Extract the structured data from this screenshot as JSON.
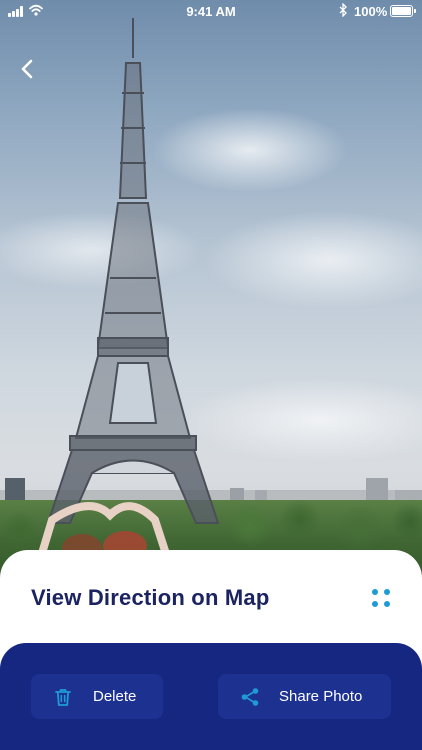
{
  "status_bar": {
    "time": "9:41 AM",
    "battery_percent": "100%",
    "battery_level": 1.0,
    "bluetooth_icon": "bluetooth-icon",
    "wifi_icon": "wifi-icon",
    "signal_icon": "cellular-signal-icon"
  },
  "header": {
    "back_icon": "chevron-left-icon"
  },
  "photo": {
    "subject_icon": "eiffel-tower-photo"
  },
  "card": {
    "title": "View Direction on Map",
    "grid_icon": "four-dots-grid-icon"
  },
  "actions": {
    "delete_label": "Delete",
    "delete_icon": "trash-icon",
    "share_label": "Share Photo",
    "share_icon": "share-icon"
  },
  "colors": {
    "title_text": "#1b2361",
    "panel_bg": "#152780",
    "button_bg": "#1d3191",
    "accent_icon": "#1e9bd7"
  }
}
